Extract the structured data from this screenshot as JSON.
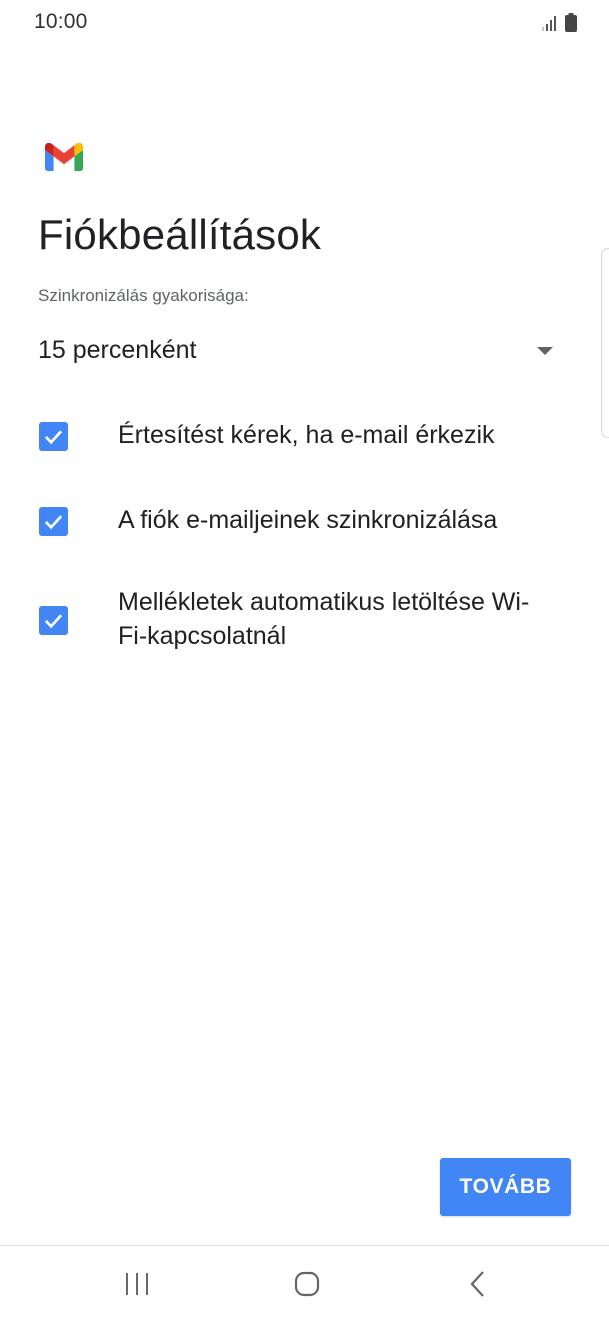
{
  "status_bar": {
    "time": "10:00",
    "icons": [
      "signal-icon",
      "battery-icon"
    ]
  },
  "app": {
    "logo": "gmail-logo"
  },
  "page": {
    "title": "Fiókbeállítások"
  },
  "sync": {
    "label": "Szinkronizálás gyakorisága:",
    "selected": "15 percenként"
  },
  "options": [
    {
      "label": "Értesítést kérek, ha e-mail érkezik",
      "checked": true
    },
    {
      "label": "A fiók e-mailjeinek szinkronizálása",
      "checked": true
    },
    {
      "label": "Mellékletek automatikus letöltése Wi-Fi-kapcsolatnál",
      "checked": true
    }
  ],
  "actions": {
    "next_label": "TOVÁBB"
  },
  "navigation": {
    "buttons": [
      "recents-icon",
      "home-icon",
      "back-icon"
    ]
  },
  "colors": {
    "accent": "#4285f4",
    "text": "#202124",
    "secondary_text": "#5f6368"
  }
}
